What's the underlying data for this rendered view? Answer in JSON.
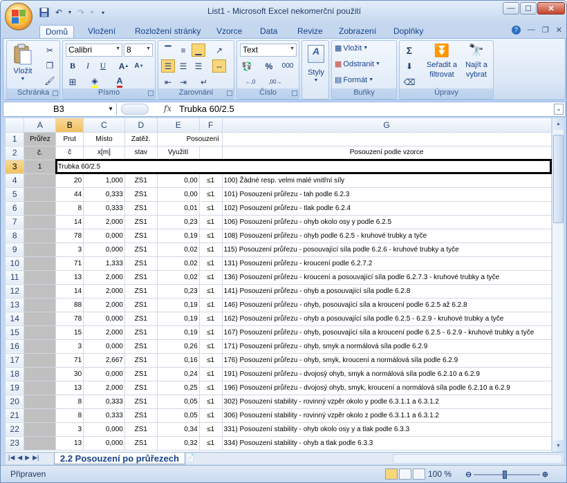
{
  "window": {
    "title": "List1 - Microsoft Excel nekomerční použití"
  },
  "tabs": [
    "Domů",
    "Vložení",
    "Rozložení stránky",
    "Vzorce",
    "Data",
    "Revize",
    "Zobrazení",
    "Doplňky"
  ],
  "ribbon": {
    "clipboard": {
      "paste": "Vložit",
      "label": "Schránka"
    },
    "font": {
      "name": "Calibri",
      "size": "8",
      "bold": "B",
      "italic": "I",
      "underline": "U",
      "label": "Písmo"
    },
    "alignment": {
      "label": "Zarovnání"
    },
    "number": {
      "format": "Text",
      "percent": "%",
      "thousands": "000",
      "label": "Číslo"
    },
    "styles": {
      "label": "Styly"
    },
    "cells": {
      "insert": "Vložit",
      "delete": "Odstranit",
      "format": "Formát",
      "label": "Buňky"
    },
    "editing": {
      "sort": "Seřadit a",
      "sort2": "filtrovat",
      "find": "Najít a",
      "find2": "vybrat",
      "label": "Úpravy"
    }
  },
  "formula_bar": {
    "name_box": "B3",
    "fx": "fx",
    "value": "Trubka 60/2.5"
  },
  "columns": [
    "A",
    "B",
    "C",
    "D",
    "E",
    "F",
    "G"
  ],
  "header_rows": {
    "r1": {
      "A": "Průřez",
      "B": "Prut",
      "C": "Místo",
      "D": "Zatěž.",
      "E": "Posouzení",
      "F": "",
      "G": ""
    },
    "r2": {
      "A": "č.",
      "B": "č",
      "C": "x[m]",
      "D": "stav",
      "E": "Využití",
      "F": "",
      "G": "Posouzení podle vzorce"
    }
  },
  "row3": {
    "num": "3",
    "A": "1",
    "B": "Trubka 60/2.5"
  },
  "rows": [
    {
      "num": "4",
      "B": "20",
      "C": "1,000",
      "D": "ZS1",
      "E": "0,00",
      "F": "≤1",
      "G": "100) Žádné resp. velmi malé vnitřní síly"
    },
    {
      "num": "5",
      "B": "44",
      "C": "0,333",
      "D": "ZS1",
      "E": "0,00",
      "F": "≤1",
      "G": "101) Posouzení průřezu - tah podle 6.2.3"
    },
    {
      "num": "6",
      "B": "8",
      "C": "0,333",
      "D": "ZS1",
      "E": "0,01",
      "F": "≤1",
      "G": "102) Posouzení průřezu - tlak podle 6.2.4"
    },
    {
      "num": "7",
      "B": "14",
      "C": "2,000",
      "D": "ZS1",
      "E": "0,23",
      "F": "≤1",
      "G": "106) Posouzení průřezu - ohyb okolo osy y podle 6.2.5"
    },
    {
      "num": "8",
      "B": "78",
      "C": "0,000",
      "D": "ZS1",
      "E": "0,19",
      "F": "≤1",
      "G": "108) Posouzení průřezu - ohyb podle 6.2.5 - kruhové trubky a tyče"
    },
    {
      "num": "9",
      "B": "3",
      "C": "0,000",
      "D": "ZS1",
      "E": "0,02",
      "F": "≤1",
      "G": "115) Posouzení průřezu - posouvající síla podle 6.2.6 - kruhové trubky a tyče"
    },
    {
      "num": "10",
      "B": "71",
      "C": "1,333",
      "D": "ZS1",
      "E": "0,02",
      "F": "≤1",
      "G": "131) Posouzení průřezu - kroucení podle 6.2.7.2"
    },
    {
      "num": "11",
      "B": "13",
      "C": "2,000",
      "D": "ZS1",
      "E": "0,02",
      "F": "≤1",
      "G": "136) Posouzení průřezu - kroucení a posouvající síla podle 6.2.7.3 - kruhové trubky a tyče"
    },
    {
      "num": "12",
      "B": "14",
      "C": "2,000",
      "D": "ZS1",
      "E": "0,23",
      "F": "≤1",
      "G": "141) Posouzení průřezu - ohyb a posouvající síla podle 6.2.8"
    },
    {
      "num": "13",
      "B": "88",
      "C": "2,000",
      "D": "ZS1",
      "E": "0,19",
      "F": "≤1",
      "G": "146) Posouzení průřezu - ohyb, posouvající síla a kroucení podle 6.2.5 až 6.2.8"
    },
    {
      "num": "14",
      "B": "78",
      "C": "0,000",
      "D": "ZS1",
      "E": "0,19",
      "F": "≤1",
      "G": "162) Posouzení průřezu - ohyb a posouvající síla podle 6.2.5 - 6.2.9 - kruhové trubky a tyče"
    },
    {
      "num": "15",
      "B": "15",
      "C": "2,000",
      "D": "ZS1",
      "E": "0,19",
      "F": "≤1",
      "G": "167) Posouzení průřezu - ohyb, posouvající síla a kroucení podle 6.2.5 - 6.2.9 - kruhové trubky a tyče"
    },
    {
      "num": "16",
      "B": "3",
      "C": "0,000",
      "D": "ZS1",
      "E": "0,26",
      "F": "≤1",
      "G": "171) Posouzení průřezu - ohyb, smyk a normálová síla podle 6.2.9"
    },
    {
      "num": "17",
      "B": "71",
      "C": "2,667",
      "D": "ZS1",
      "E": "0,16",
      "F": "≤1",
      "G": "176) Posouzení průřezu - ohyb, smyk, kroucení a normálová síla podle 6.2.9"
    },
    {
      "num": "18",
      "B": "30",
      "C": "0,000",
      "D": "ZS1",
      "E": "0,24",
      "F": "≤1",
      "G": "191) Posouzení průřezu - dvojosý ohyb, smyk a normálová síla podle 6.2.10 a 6.2.9"
    },
    {
      "num": "19",
      "B": "13",
      "C": "2,000",
      "D": "ZS1",
      "E": "0,25",
      "F": "≤1",
      "G": "196) Posouzení průřezu - dvojosý ohyb, smyk, kroucení a normálová síla podle 6.2.10 a 6.2.9"
    },
    {
      "num": "20",
      "B": "8",
      "C": "0,333",
      "D": "ZS1",
      "E": "0,05",
      "F": "≤1",
      "G": "302) Posouzení stability - rovinný vzpěr okolo y podle 6.3.1.1 a 6.3.1.2"
    },
    {
      "num": "21",
      "B": "8",
      "C": "0,333",
      "D": "ZS1",
      "E": "0,05",
      "F": "≤1",
      "G": "306) Posouzení stability - rovinný vzpěr okolo z podle 6.3.1.1 a 6.3.1.2"
    },
    {
      "num": "22",
      "B": "3",
      "C": "0,000",
      "D": "ZS1",
      "E": "0,34",
      "F": "≤1",
      "G": "331) Posouzení stability - ohyb okolo osy y a tlak podle 6.3.3"
    },
    {
      "num": "23",
      "B": "13",
      "C": "0,000",
      "D": "ZS1",
      "E": "0,32",
      "F": "≤1",
      "G": "334) Posouzení stability - ohyb a tlak podle 6.3.3"
    }
  ],
  "sheet_tab": "2.2 Posouzení po průřezech",
  "status": {
    "text": "Připraven",
    "zoom": "100 %"
  }
}
